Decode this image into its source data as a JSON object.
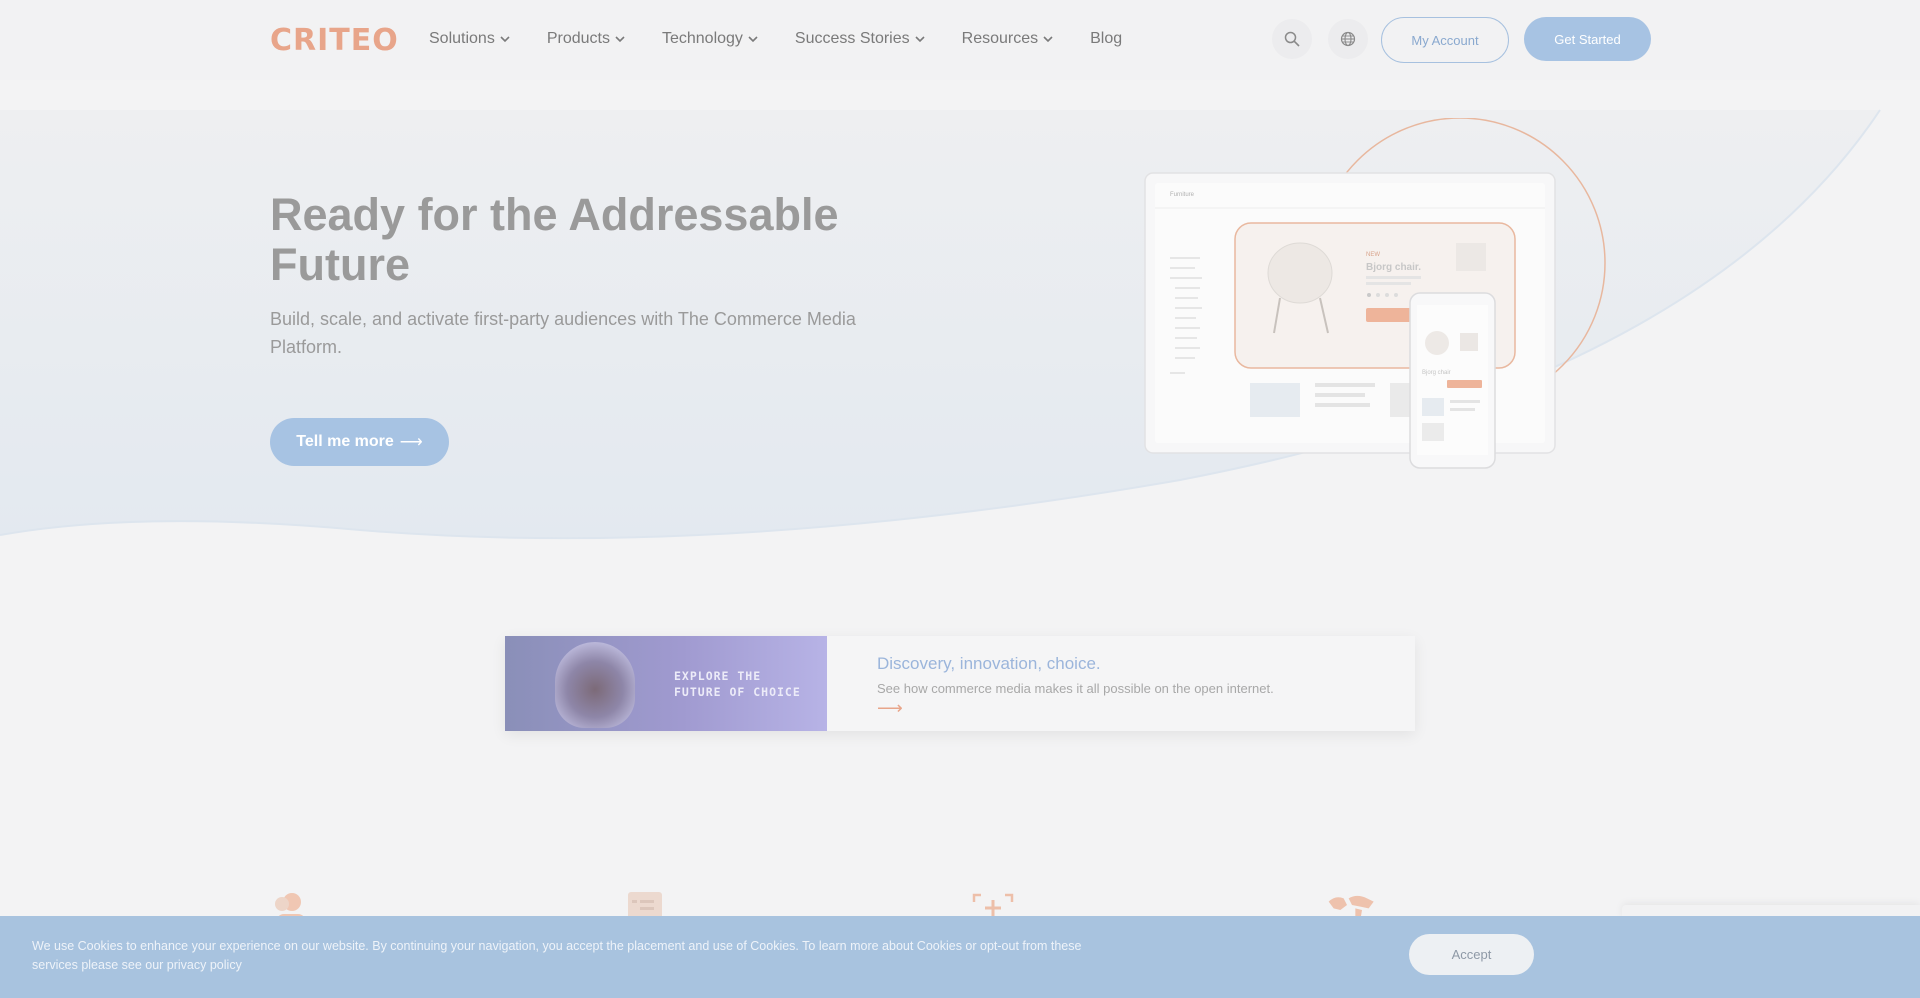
{
  "header": {
    "logo_text": "CRITEO",
    "nav": [
      {
        "label": "Solutions",
        "has_dropdown": true
      },
      {
        "label": "Products",
        "has_dropdown": true
      },
      {
        "label": "Technology",
        "has_dropdown": true
      },
      {
        "label": "Success Stories",
        "has_dropdown": true
      },
      {
        "label": "Resources",
        "has_dropdown": true
      },
      {
        "label": "Blog",
        "has_dropdown": false
      }
    ],
    "search_icon": "search-icon",
    "language_icon": "globe-icon",
    "my_account_label": "My Account",
    "get_started_label": "Get Started"
  },
  "hero": {
    "title": "Ready for the Addressable Future",
    "subtitle": "Build, scale, and activate first-party audiences with The Commerce Media Platform.",
    "cta_label": "Tell me more",
    "cta_arrow": "⟶",
    "mockup": {
      "brand": "Furniture",
      "product_tag": "NEW",
      "product_name": "Bjorg chair.",
      "mobile_product_name": "Bjorg chair"
    }
  },
  "promo": {
    "image_text_line1": "EXPLORE THE",
    "image_text_line2": "FUTURE OF CHOICE",
    "title": "Discovery, innovation, choice.",
    "description": "See how commerce media makes it all possible on the open internet.",
    "arrow": "⟶"
  },
  "features": {
    "icons": [
      "audience-icon",
      "catalog-icon",
      "add-media-icon",
      "world-map-icon"
    ]
  },
  "cookie_banner": {
    "text": "We use Cookies to enhance your experience on our website. By continuing your navigation, you accept the placement and use of Cookies. To learn more about Cookies or opt-out from these services please see our privacy policy",
    "accept_label": "Accept"
  },
  "colors": {
    "brand_orange": "#e8a58a",
    "accent_blue": "#a7c3e3",
    "hero_curve": "#e2e9f1",
    "cookie_bg": "#a8c3df"
  }
}
